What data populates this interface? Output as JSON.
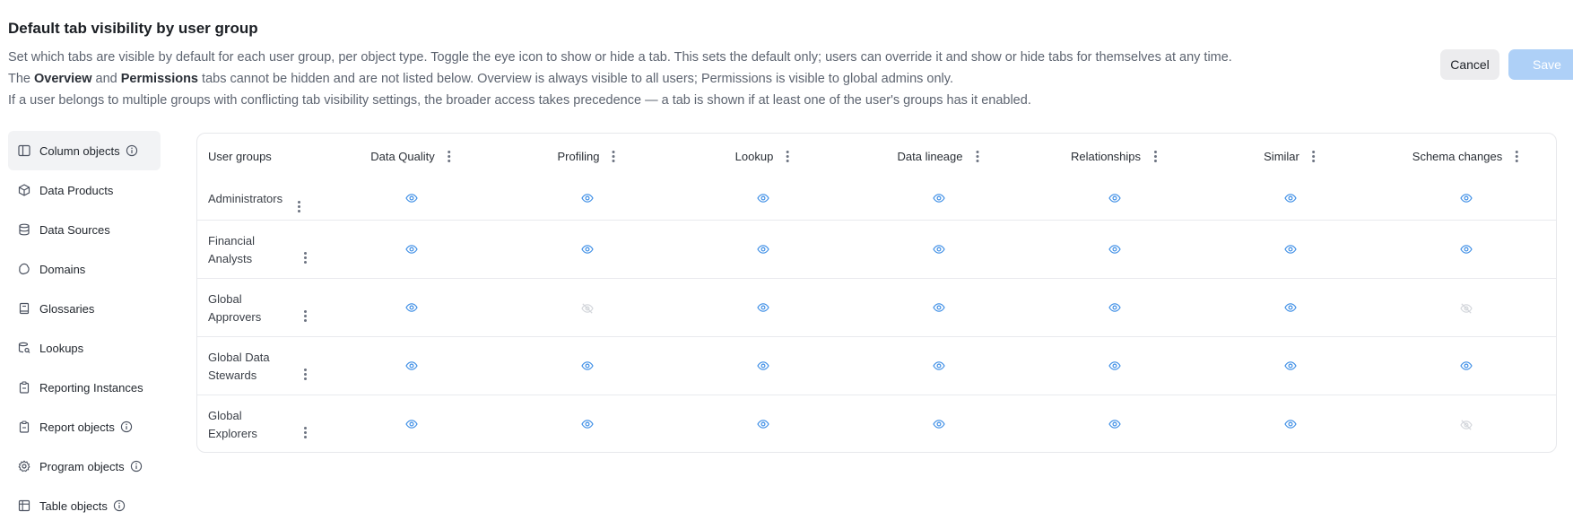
{
  "page": {
    "title": "Default tab visibility by user group",
    "desc_line1": "Set which tabs are visible by default for each user group, per object type. Toggle the eye icon to show or hide a tab. This sets the default only; users can override it and show or hide tabs for themselves at any time.",
    "desc_line2_a": "The ",
    "desc_line2_overview": "Overview",
    "desc_line2_b": " and ",
    "desc_line2_permissions": "Permissions",
    "desc_line2_c": " tabs cannot be hidden and are not listed below. Overview is always visible to all users; Permissions is visible to global admins only.",
    "desc_line3": "If a user belongs to multiple groups with conflicting tab visibility settings, the broader access takes precedence — a tab is shown if at least one of the user's groups has it enabled."
  },
  "actions": {
    "cancel_label": "Cancel",
    "save_label": "Save"
  },
  "sidebar": {
    "items": [
      {
        "label": "Column objects",
        "icon": "columns-icon",
        "info": true,
        "active": true
      },
      {
        "label": "Data Products",
        "icon": "package-icon",
        "info": false,
        "active": false
      },
      {
        "label": "Data Sources",
        "icon": "database-icon",
        "info": false,
        "active": false
      },
      {
        "label": "Domains",
        "icon": "domain-icon",
        "info": false,
        "active": false
      },
      {
        "label": "Glossaries",
        "icon": "book-icon",
        "info": false,
        "active": false
      },
      {
        "label": "Lookups",
        "icon": "lookup-icon",
        "info": false,
        "active": false
      },
      {
        "label": "Reporting Instances",
        "icon": "clipboard-icon",
        "info": false,
        "active": false
      },
      {
        "label": "Report objects",
        "icon": "clipboard-icon",
        "info": true,
        "active": false
      },
      {
        "label": "Program objects",
        "icon": "gear-icon",
        "info": true,
        "active": false
      },
      {
        "label": "Table objects",
        "icon": "table-icon",
        "info": true,
        "active": false
      }
    ]
  },
  "table": {
    "user_groups_header": "User groups",
    "columns": [
      "Data Quality",
      "Profiling",
      "Lookup",
      "Data lineage",
      "Relationships",
      "Similar",
      "Schema changes"
    ],
    "rows": [
      {
        "name_line1": "Administrators",
        "name_line2": "",
        "visible": [
          true,
          true,
          true,
          true,
          true,
          true,
          true
        ]
      },
      {
        "name_line1": "Financial",
        "name_line2": "Analysts",
        "visible": [
          true,
          true,
          true,
          true,
          true,
          true,
          true
        ]
      },
      {
        "name_line1": "Global",
        "name_line2": "Approvers",
        "visible": [
          true,
          false,
          true,
          true,
          true,
          true,
          false
        ]
      },
      {
        "name_line1": "Global Data",
        "name_line2": "Stewards",
        "visible": [
          true,
          true,
          true,
          true,
          true,
          true,
          true
        ]
      },
      {
        "name_line1": "Global",
        "name_line2": "Explorers",
        "visible": [
          true,
          true,
          true,
          true,
          true,
          true,
          false
        ]
      }
    ]
  },
  "colors": {
    "eye_visible": "#3f8fe6",
    "eye_hidden": "#d3d6db",
    "save_bg": "#aed0f7"
  }
}
